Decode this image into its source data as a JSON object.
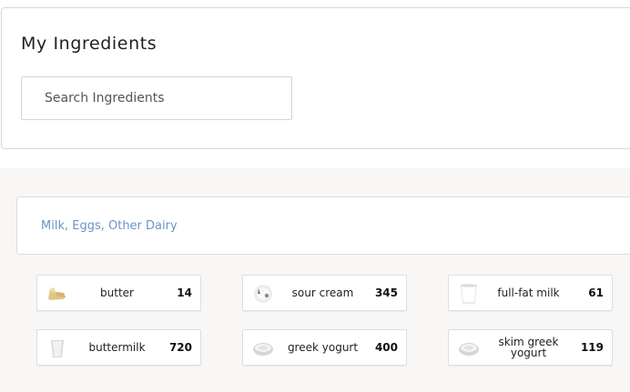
{
  "header": {
    "title": "My Ingredients",
    "search_placeholder": "Search Ingredients",
    "search_value": ""
  },
  "category": {
    "label": "Milk, Eggs, Other Dairy",
    "color": "#6b94c4"
  },
  "ingredients": [
    {
      "name": "butter",
      "count": "14",
      "icon": "butter-icon"
    },
    {
      "name": "sour cream",
      "count": "345",
      "icon": "sour-cream-icon"
    },
    {
      "name": "full-fat milk",
      "count": "61",
      "icon": "milk-glass-icon"
    },
    {
      "name": "buttermilk",
      "count": "720",
      "icon": "buttermilk-glass-icon"
    },
    {
      "name": "greek yogurt",
      "count": "400",
      "icon": "yogurt-bowl-icon"
    },
    {
      "name": "skim greek yogurt",
      "count": "119",
      "icon": "yogurt-bowl-icon"
    }
  ]
}
